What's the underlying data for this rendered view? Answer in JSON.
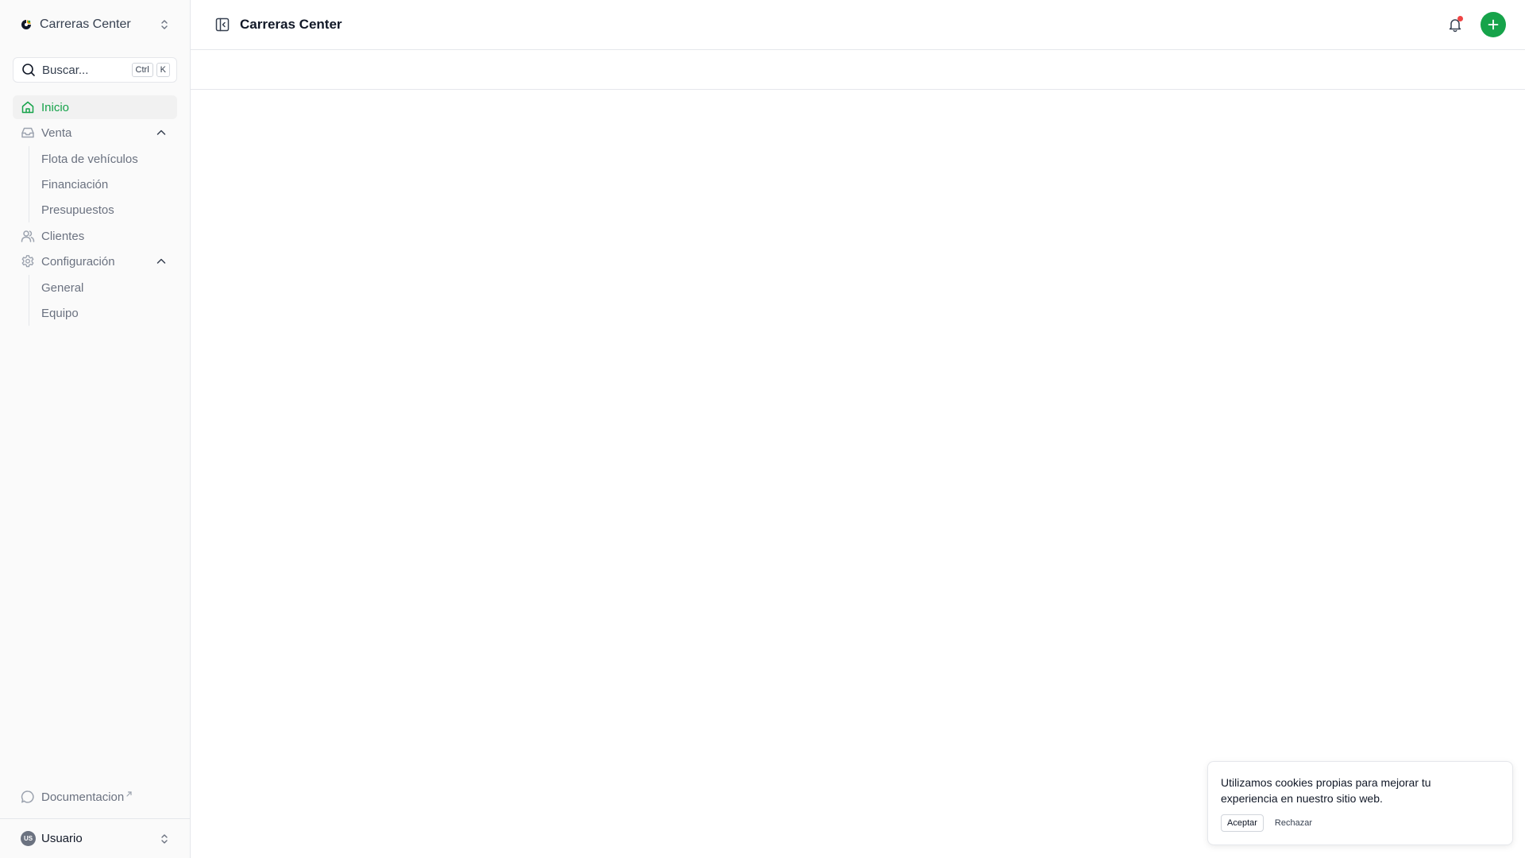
{
  "workspace": {
    "name": "Carreras Center",
    "logo_icon": "brand-logo-icon"
  },
  "search": {
    "placeholder": "Buscar...",
    "shortcut_key1": "Ctrl",
    "shortcut_key2": "K"
  },
  "nav": {
    "home": "Inicio",
    "sales": "Venta",
    "sales_items": [
      "Flota de vehículos",
      "Financiación",
      "Presupuestos"
    ],
    "clients": "Clientes",
    "settings": "Configuración",
    "settings_items": [
      "General",
      "Equipo"
    ]
  },
  "bottom": {
    "docs": "Documentacion",
    "user": "Usuario",
    "user_initials": "US"
  },
  "header": {
    "title": "Carreras Center"
  },
  "cookie": {
    "message": "Utilizamos cookies propias para mejorar tu experiencia en nuestro sitio web.",
    "accept": "Aceptar",
    "reject": "Rechazar"
  },
  "colors": {
    "accent": "#16a34a",
    "notification_dot": "#ef4444"
  }
}
